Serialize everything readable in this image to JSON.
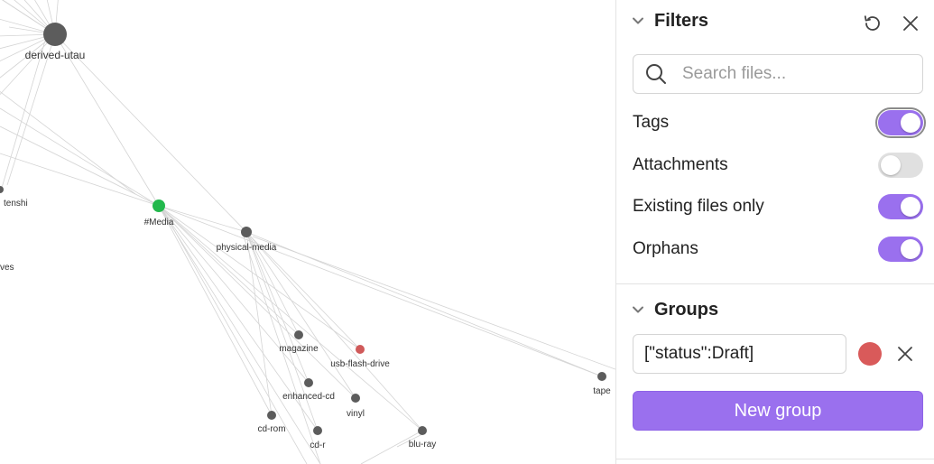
{
  "graph": {
    "nodes": [
      {
        "id": "derived-utau",
        "label": "derived-utau",
        "color": "#5c5c5c"
      },
      {
        "id": "tenshi",
        "label": "tenshi",
        "color": "#5c5c5c"
      },
      {
        "id": "ves",
        "label": "ves",
        "color": "#5c5c5c"
      },
      {
        "id": "media",
        "label": "#Media",
        "color": "#22b84c"
      },
      {
        "id": "physical-media",
        "label": "physical-media",
        "color": "#5c5c5c"
      },
      {
        "id": "magazine",
        "label": "magazine",
        "color": "#5c5c5c"
      },
      {
        "id": "usb-flash-drive",
        "label": "usb-flash-drive",
        "color": "#d05a5a"
      },
      {
        "id": "enhanced-cd",
        "label": "enhanced-cd",
        "color": "#5c5c5c"
      },
      {
        "id": "vinyl",
        "label": "vinyl",
        "color": "#5c5c5c"
      },
      {
        "id": "cd-rom",
        "label": "cd-rom",
        "color": "#5c5c5c"
      },
      {
        "id": "cd-r",
        "label": "cd-r",
        "color": "#5c5c5c"
      },
      {
        "id": "blu-ray",
        "label": "blu-ray",
        "color": "#5c5c5c"
      },
      {
        "id": "tape",
        "label": "tape",
        "color": "#5c5c5c"
      }
    ],
    "edge_color": "#d4d4d4"
  },
  "filters": {
    "title": "Filters",
    "reset_icon": "restore-icon",
    "close_icon": "close-icon",
    "search_placeholder": "Search files...",
    "search_value": "",
    "toggles": [
      {
        "label": "Tags",
        "on": true
      },
      {
        "label": "Attachments",
        "on": false
      },
      {
        "label": "Existing files only",
        "on": true
      },
      {
        "label": "Orphans",
        "on": true
      }
    ]
  },
  "groups": {
    "title": "Groups",
    "items": [
      {
        "query": "[\"status\":Draft]",
        "color": "#d95a5a"
      }
    ],
    "new_group_label": "New group"
  },
  "colors": {
    "accent": "#9a70ee",
    "toggle_off": "#e0e0e0"
  }
}
